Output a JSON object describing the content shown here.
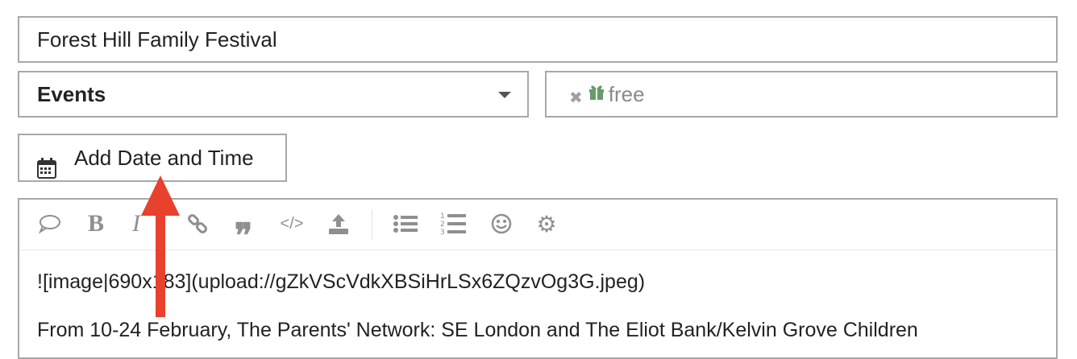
{
  "title_field": {
    "value": "Forest Hill Family Festival"
  },
  "category_select": {
    "selected": "Events"
  },
  "tags_field": {
    "tags": [
      {
        "label": "free",
        "icon": "gift-icon"
      }
    ]
  },
  "date_button": {
    "label": "Add Date and Time",
    "icon": "calendar-icon"
  },
  "editor": {
    "toolbar": [
      "speech-bubble-icon",
      "bold-icon",
      "italic-icon",
      "link-icon",
      "quote-icon",
      "code-icon",
      "upload-icon",
      "bullet-list-icon",
      "numbered-list-icon",
      "emoji-icon",
      "gear-icon"
    ],
    "body_lines": [
      "![image|690x183](upload://gZkVScVdkXBSiHrLSx6ZQzvOg3G.jpeg)",
      "From 10-24 February, The Parents' Network: SE London and The Eliot Bank/Kelvin Grove Children"
    ]
  },
  "colors": {
    "border": "#a8a8a8",
    "tag_icon": "#6a9a6a",
    "arrow": "#e8412c",
    "toolbar_icon": "#8f8f8f"
  }
}
